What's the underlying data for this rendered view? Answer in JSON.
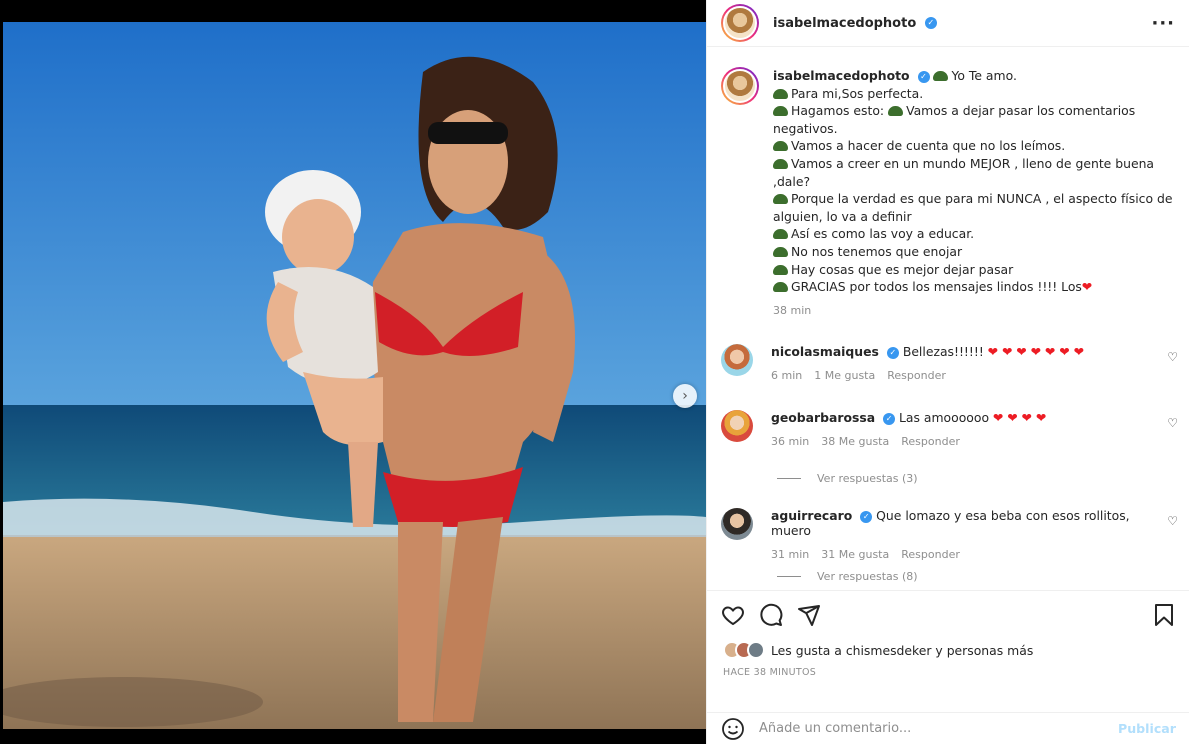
{
  "post": {
    "username": "isabelmacedophoto",
    "caption_lines": [
      "Yo Te amo.",
      "Para mi,Sos perfecta.",
      "Hagamos esto:",
      "Vamos a dejar pasar los comentarios negativos.",
      "Vamos a hacer de cuenta que no los leímos.",
      "Vamos a creer en un mundo MEJOR , lleno de gente buena ,dale?",
      "Porque la verdad es que para mi NUNCA , el aspecto físico de alguien, lo va a definir",
      "Así es como las voy a educar.",
      "No nos tenemos que enojar",
      "Hay cosas que es mejor dejar pasar",
      "GRACIAS por todos los mensajes lindos !!!! Los"
    ],
    "caption_time": "38 min",
    "colors": {
      "verified": "#3897f0",
      "heart": "#ed1c24",
      "publish": "#b2dffc",
      "meta": "#8e8e8e"
    }
  },
  "comments": [
    {
      "user": "nicolasmaiques",
      "text": "Bellezas!!!!!!",
      "hearts": 7,
      "time": "6 min",
      "likes": "1 Me gusta",
      "reply": "Responder"
    },
    {
      "user": "geobarbarossa",
      "text": "Las amoooooo",
      "hearts": 4,
      "time": "36 min",
      "likes": "38 Me gusta",
      "reply": "Responder",
      "replies_label": "Ver respuestas (3)"
    },
    {
      "user": "aguirrecaro",
      "text": "Que lomazo y esa beba con esos rollitos, muero",
      "hearts": 0,
      "time": "31 min",
      "likes": "31 Me gusta",
      "reply": "Responder",
      "replies_label": "Ver respuestas (8)"
    }
  ],
  "actions": {
    "likes_prefix": "Les gusta a",
    "likes_user": "chismesdeker",
    "likes_suffix": "y personas más",
    "ago": "HACE 38 MINUTOS"
  },
  "composer": {
    "placeholder": "Añade un comentario...",
    "publish": "Publicar"
  },
  "carousel": {
    "slide": 1,
    "total": 2
  },
  "icons": [
    "more-icon",
    "verified-icon",
    "heart-icon",
    "comment-icon",
    "share-icon",
    "bookmark-icon",
    "emoji-icon",
    "next-arrow-icon"
  ]
}
